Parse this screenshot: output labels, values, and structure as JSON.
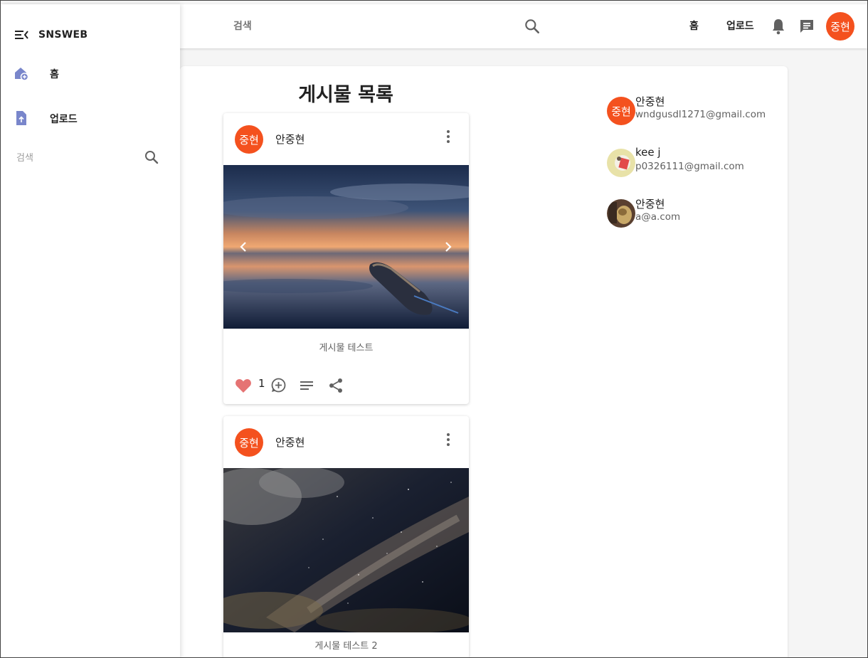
{
  "appbar": {
    "search_label": "검색",
    "nav_home": "홈",
    "nav_upload": "업로드",
    "avatar_text": "중현",
    "icons": [
      "search-icon",
      "bell-icon",
      "chat-icon"
    ]
  },
  "drawer": {
    "brand": "SNSWEB",
    "items": [
      {
        "label": "홈",
        "icon": "home-icon"
      },
      {
        "label": "업로드",
        "icon": "upload-file-icon"
      }
    ],
    "search_label": "검색"
  },
  "main": {
    "title": "게시물 목록",
    "posts": [
      {
        "author": "안중현",
        "avatar_text": "중현",
        "caption": "게시물 테스트",
        "likes": "1",
        "image": "sunset-boat-photo"
      },
      {
        "author": "안중현",
        "avatar_text": "중현",
        "caption": "게시물 테스트 2",
        "image": "night-sky-photo"
      }
    ]
  },
  "friends": [
    {
      "name": "안중현",
      "email": "wndgusdl1271@gmail.com",
      "avatar_text": "중현"
    },
    {
      "name": "kee j",
      "email": "p0326111@gmail.com"
    },
    {
      "name": "안중현",
      "email": "a@a.com"
    }
  ],
  "colors": {
    "accent": "#f4511e",
    "like": "#e57373",
    "drawer_icon": "#7986cb"
  }
}
